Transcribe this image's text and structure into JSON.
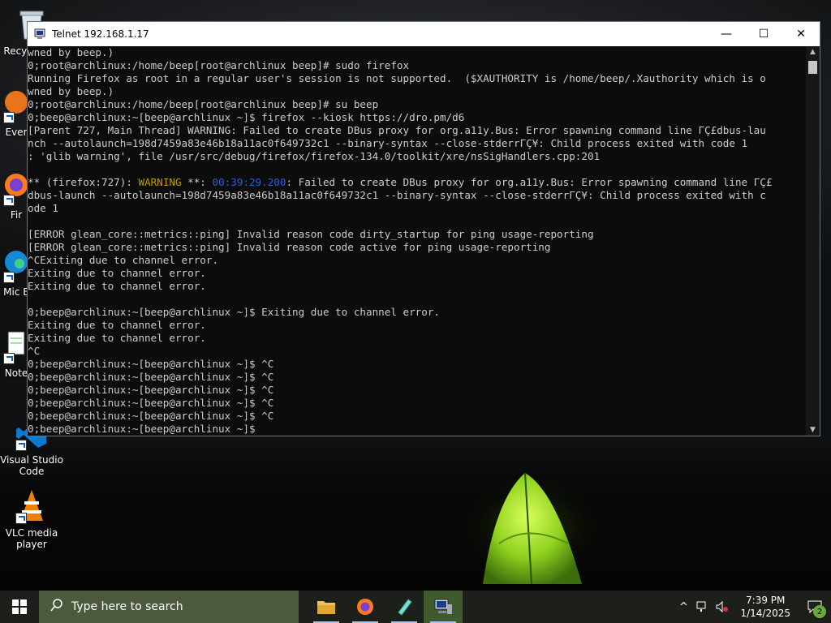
{
  "window": {
    "title": "Telnet 192.168.1.17",
    "minimize_glyph": "—",
    "maximize_glyph": "☐",
    "close_glyph": "✕"
  },
  "desktop": {
    "icons": [
      {
        "label": "Recycle Bin",
        "icon": "recycle-bin-icon"
      },
      {
        "label": "Ever",
        "icon": "evernote-icon"
      },
      {
        "label": "Fir",
        "icon": "firefox-icon"
      },
      {
        "label": "Mic E",
        "icon": "edge-icon"
      },
      {
        "label": "Note",
        "icon": "notepad-icon"
      },
      {
        "label": "Visual Studio Code",
        "icon": "vscode-icon"
      },
      {
        "label": "VLC media player",
        "icon": "vlc-icon"
      }
    ]
  },
  "terminal": {
    "lines": [
      "wned by beep.)",
      "0;root@archlinux:/home/beep[root@archlinux beep]# sudo firefox",
      "Running Firefox as root in a regular user's session is not supported.  ($XAUTHORITY is /home/beep/.Xauthority which is o",
      "wned by beep.)",
      "0;root@archlinux:/home/beep[root@archlinux beep]# su beep",
      "0;beep@archlinux:~[beep@archlinux ~]$ firefox --kiosk https://dro.pm/d6",
      "[Parent 727, Main Thread] WARNING: Failed to create DBus proxy for org.a11y.Bus: Error spawning command line ΓÇ£dbus-lau",
      "nch --autolaunch=198d7459a83e46b18a11ac0f649732c1 --binary-syntax --close-stderrΓÇ¥: Child process exited with code 1",
      ": 'glib warning', file /usr/src/debug/firefox/firefox-134.0/toolkit/xre/nsSigHandlers.cpp:201",
      "",
      "",
      "dbus-launch --autolaunch=198d7459a83e46b18a11ac0f649732c1 --binary-syntax --close-stderrΓÇ¥: Child process exited with c",
      "ode 1",
      "",
      "[ERROR glean_core::metrics::ping] Invalid reason code dirty_startup for ping usage-reporting",
      "[ERROR glean_core::metrics::ping] Invalid reason code active for ping usage-reporting",
      "^CExiting due to channel error.",
      "Exiting due to channel error.",
      "Exiting due to channel error.",
      "",
      "0;beep@archlinux:~[beep@archlinux ~]$ Exiting due to channel error.",
      "Exiting due to channel error.",
      "Exiting due to channel error.",
      "^C",
      "0;beep@archlinux:~[beep@archlinux ~]$ ^C",
      "0;beep@archlinux:~[beep@archlinux ~]$ ^C",
      "0;beep@archlinux:~[beep@archlinux ~]$ ^C",
      "0;beep@archlinux:~[beep@archlinux ~]$ ^C",
      "0;beep@archlinux:~[beep@archlinux ~]$ ^C",
      "0;beep@archlinux:~[beep@archlinux ~]$"
    ],
    "warn_line": {
      "prefix": "** (firefox:727): ",
      "warning": "WARNING",
      "stars": " **: ",
      "timestamp": "00:39:29.200",
      "rest": ": Failed to create DBus proxy for org.a11y.Bus: Error spawning command line ΓÇ£"
    },
    "colors": {
      "warning": "#c19c00",
      "timestamp": "#2c5fd0",
      "text": "#cccccc"
    }
  },
  "taskbar": {
    "search_placeholder": "Type here to search",
    "apps": [
      {
        "name": "file-explorer-icon"
      },
      {
        "name": "firefox-icon"
      },
      {
        "name": "notepad-icon"
      },
      {
        "name": "telnet-icon",
        "active": true
      }
    ],
    "clock_time": "7:39 PM",
    "clock_date": "1/14/2025",
    "notification_count": "2"
  }
}
